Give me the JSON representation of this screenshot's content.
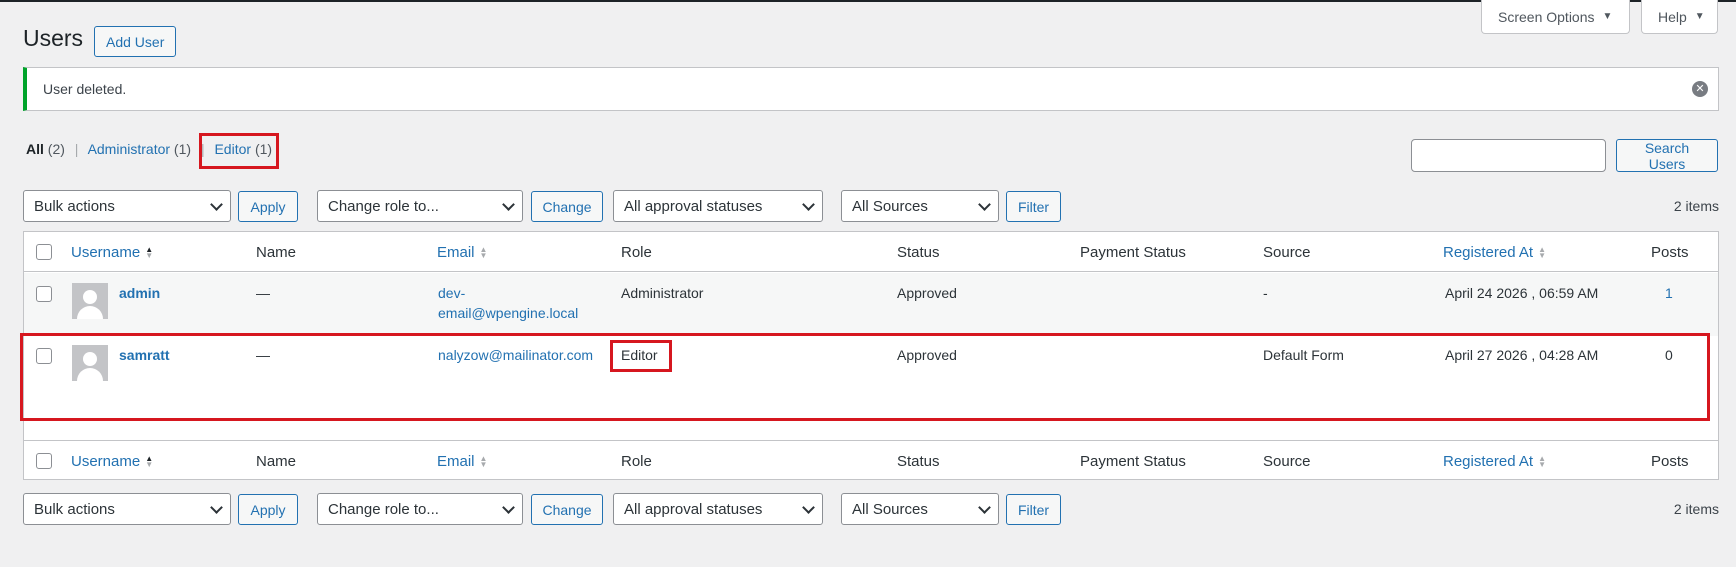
{
  "header": {
    "title": "Users",
    "add_user_label": "Add User",
    "screen_options_label": "Screen Options",
    "help_label": "Help"
  },
  "notice": {
    "message": "User deleted."
  },
  "views": {
    "all_label": "All",
    "all_count": "(2)",
    "administrator_label": "Administrator",
    "administrator_count": "(1)",
    "editor_label": "Editor",
    "editor_count": "(1)",
    "separator": "|"
  },
  "search": {
    "value": "",
    "button_label": "Search Users"
  },
  "tablenav": {
    "bulk_actions": "Bulk actions",
    "apply_label": "Apply",
    "change_role": "Change role to...",
    "change_label": "Change",
    "approval_statuses": "All approval statuses",
    "sources": "All Sources",
    "filter_label": "Filter",
    "items_count": "2 items"
  },
  "columns": {
    "username": "Username",
    "name": "Name",
    "email": "Email",
    "role": "Role",
    "status": "Status",
    "payment_status": "Payment Status",
    "source": "Source",
    "registered_at": "Registered At",
    "posts": "Posts"
  },
  "rows": [
    {
      "username": "admin",
      "name": "—",
      "email_line1": "dev-",
      "email_line2": "email@wpengine.local",
      "role": "Administrator",
      "status": "Approved",
      "payment_status": "",
      "source": "-",
      "registered_at": "April 24 2026 , 06:59 AM",
      "posts": "1"
    },
    {
      "username": "samratt",
      "name": "—",
      "email": "nalyzow@mailinator.com",
      "role": "Editor",
      "status": "Approved",
      "payment_status": "",
      "source": "Default Form",
      "registered_at": "April 27 2026 , 04:28 AM",
      "posts": "0"
    }
  ],
  "colors": {
    "accent": "#2271b1",
    "success": "#00a32a",
    "highlight": "#d6171f",
    "background": "#f0f0f1"
  },
  "icons": {
    "dismiss": "dismiss-icon",
    "avatar": "default-avatar-icon",
    "sort": "sort-icon",
    "dropdown": "chevron-down-icon"
  }
}
